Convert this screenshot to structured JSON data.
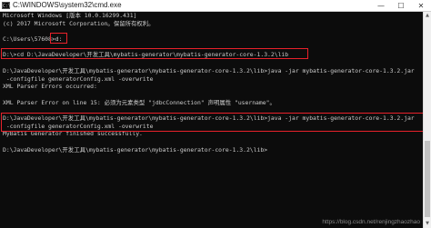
{
  "window": {
    "title": "C:\\WINDOWS\\system32\\cmd.exe",
    "controls": {
      "minimize": "—",
      "maximize": "☐",
      "close": "✕"
    }
  },
  "console": {
    "lines": [
      "Microsoft Windows [版本 10.0.16299.431]",
      "(c) 2017 Microsoft Corporation。保留所有权利。",
      "",
      "C:\\Users\\57608>d:",
      "",
      "D:\\>cd D:\\JavaDeveloper\\开发工具\\mybatis-generator\\mybatis-generator-core-1.3.2\\lib",
      "",
      "D:\\JavaDeveloper\\开发工具\\mybatis-generator\\mybatis-generator-core-1.3.2\\lib>java -jar mybatis-generator-core-1.3.2.jar",
      " -configfile generatorConfig.xml -overwrite",
      "XML Parser Errors occurred:",
      "",
      "XML Parser Error on line 15: 必须为元素类型 \"jdbcConnection\" 声明属性 \"username\"。",
      "",
      "D:\\JavaDeveloper\\开发工具\\mybatis-generator\\mybatis-generator-core-1.3.2\\lib>java -jar mybatis-generator-core-1.3.2.jar",
      " -configfile generatorConfig.xml -overwrite",
      "MyBatis Generator finished successfully.",
      "",
      "D:\\JavaDeveloper\\开发工具\\mybatis-generator\\mybatis-generator-core-1.3.2\\lib>"
    ]
  },
  "watermark": "https://blog.csdn.net/renjingzhaozhao",
  "colors": {
    "background": "#0c0c0c",
    "text": "#cccccc",
    "highlight": "#e8212a"
  }
}
